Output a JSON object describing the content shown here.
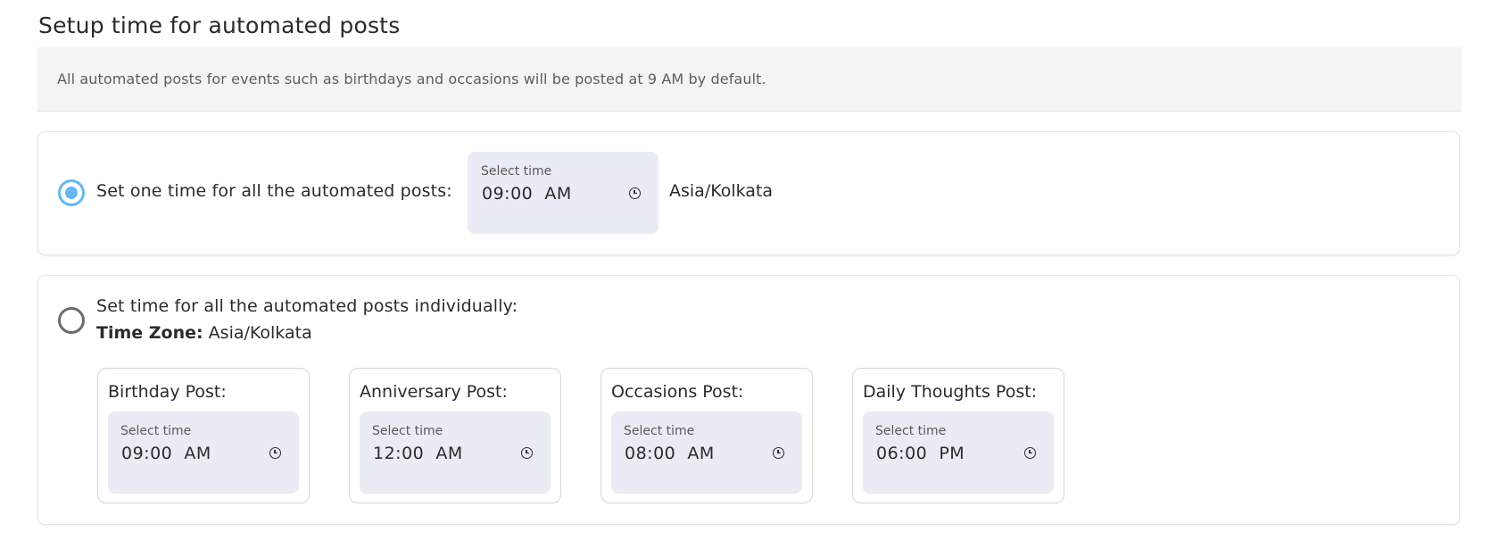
{
  "page": {
    "title": "Setup time for automated posts",
    "info": "All automated posts for events such as birthdays and occasions will be posted at 9 AM by default."
  },
  "single_option": {
    "label": "Set one time for all the automated posts:",
    "selected": true,
    "picker": {
      "caption": "Select time",
      "value": "09:00  AM"
    },
    "timezone": "Asia/Kolkata"
  },
  "individual_option": {
    "label": "Set time for all the automated posts individually:",
    "selected": false,
    "timezone_label": "Time Zone:",
    "timezone_value": "Asia/Kolkata",
    "posts": [
      {
        "title": "Birthday Post:",
        "caption": "Select time",
        "value": "09:00  AM"
      },
      {
        "title": "Anniversary Post:",
        "caption": "Select time",
        "value": "12:00  AM"
      },
      {
        "title": "Occasions Post:",
        "caption": "Select time",
        "value": "08:00  AM"
      },
      {
        "title": "Daily Thoughts Post:",
        "caption": "Select time",
        "value": "06:00  PM"
      }
    ]
  },
  "icons": {
    "clock": "clock-icon"
  },
  "colors": {
    "accent": "#63b8f2",
    "picker_bg": "#e9ecf4",
    "banner_bg": "#f4f4f4"
  }
}
